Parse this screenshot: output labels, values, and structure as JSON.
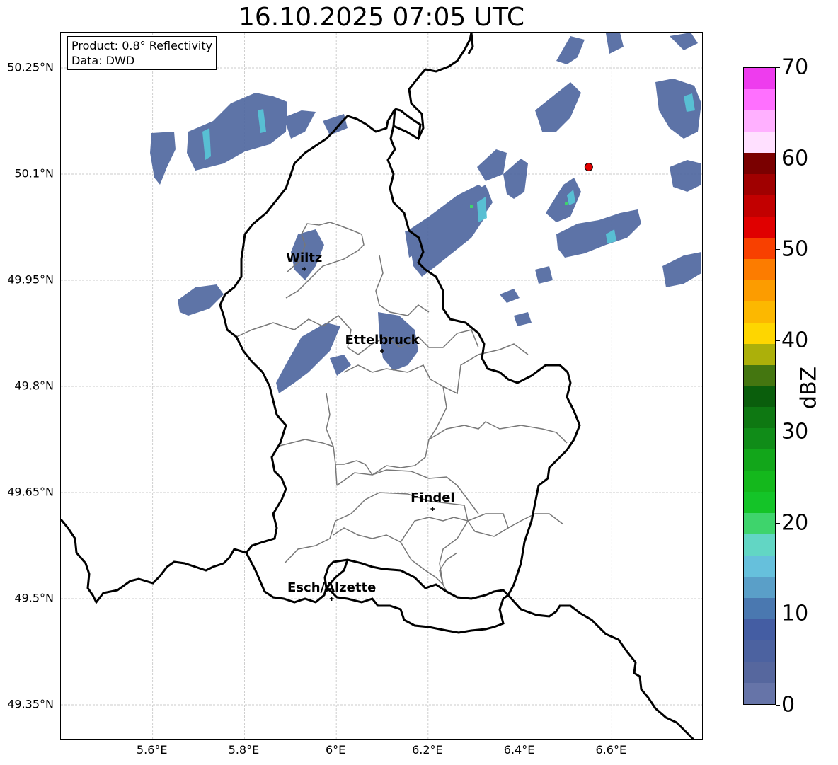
{
  "title": "16.10.2025 07:05 UTC",
  "info": {
    "product": "Product: 0.8° Reflectivity",
    "source": "Data: DWD"
  },
  "lat_ticks": [
    "50.25°N",
    "50.1°N",
    "49.95°N",
    "49.8°N",
    "49.65°N",
    "49.5°N",
    "49.35°N"
  ],
  "lon_ticks": [
    "5.6°E",
    "5.8°E",
    "6°E",
    "6.2°E",
    "6.4°E",
    "6.6°E"
  ],
  "cities": [
    {
      "name": "Wiltz",
      "lon": 5.93,
      "lat": 49.966
    },
    {
      "name": "Ettelbruck",
      "lon": 6.1,
      "lat": 49.85
    },
    {
      "name": "Findel",
      "lon": 6.21,
      "lat": 49.627
    },
    {
      "name": "Esch/Alzette",
      "lon": 5.99,
      "lat": 49.5
    }
  ],
  "marker": {
    "lon": 6.55,
    "lat": 50.11,
    "color": "#e00000"
  },
  "colorbar": {
    "label": "dBZ",
    "ticks": [
      "0",
      "10",
      "20",
      "30",
      "40",
      "50",
      "60",
      "70"
    ],
    "min": 0,
    "max": 70,
    "step": 2.5,
    "colors": [
      "#6674a8",
      "#56679e",
      "#4c62a0",
      "#445da3",
      "#4a78b0",
      "#5a9fc8",
      "#66c0dc",
      "#62d6c4",
      "#3ed46c",
      "#14c428",
      "#14b81c",
      "#12a61a",
      "#108c18",
      "#0e7812",
      "#0a5e0c",
      "#447610",
      "#acb00a",
      "#fed600",
      "#fcb800",
      "#fc9c00",
      "#fc7c00",
      "#f84000",
      "#e00000",
      "#c20000",
      "#a00000",
      "#7a0000",
      "#ffe0ff",
      "#ffb0ff",
      "#ff70ff",
      "#ee3cee"
    ]
  },
  "map": {
    "lon_range": [
      5.4,
      6.8
    ],
    "lat_range": [
      49.3,
      50.3
    ],
    "gridlines": true,
    "echo_color": "#5068a0",
    "highlight_color": "#58c8d8"
  }
}
